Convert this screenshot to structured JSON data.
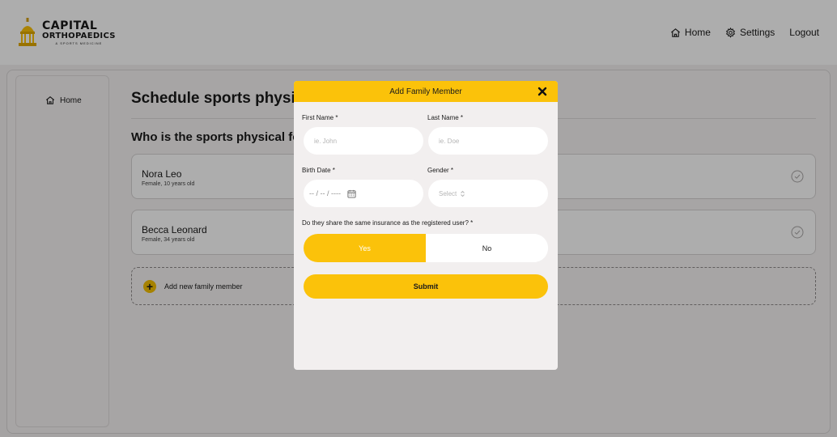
{
  "brand": {
    "line1": "CAPITAL",
    "line2": "ORTHOPAEDICS",
    "line3": "& SPORTS MEDICINE",
    "accent_color": "#fbc20a"
  },
  "topnav": {
    "home_label": "Home",
    "settings_label": "Settings",
    "logout_label": "Logout"
  },
  "sidebar": {
    "items": [
      {
        "label": "Home",
        "icon": "home-icon"
      }
    ]
  },
  "main": {
    "title": "Schedule sports physica",
    "section_title": "Who is the sports physical for?",
    "members": [
      {
        "name": "Nora Leo",
        "details": "Female, 10 years old"
      },
      {
        "name": "Becca Leonard",
        "details": "Female, 34 years old"
      }
    ],
    "add_member_label": "Add new family member"
  },
  "modal": {
    "title": "Add Family Member",
    "first_name_label": "First Name *",
    "first_name_placeholder": "ie. John",
    "last_name_label": "Last Name *",
    "last_name_placeholder": "ie. Doe",
    "birth_date_label": "Birth Date *",
    "birth_date_value": "-- / -- / ----",
    "gender_label": "Gender *",
    "gender_value": "Select",
    "insurance_question": "Do they share the same insurance as the registered user? *",
    "yes_label": "Yes",
    "no_label": "No",
    "selected": "Yes",
    "submit_label": "Submit"
  }
}
